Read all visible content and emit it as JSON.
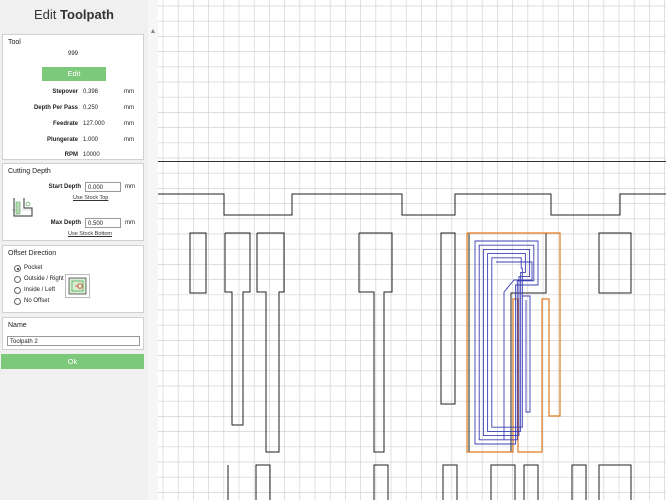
{
  "header": {
    "prefix": "Edit",
    "title": "Toolpath"
  },
  "tool": {
    "label": "Tool",
    "name": "999",
    "edit_label": "Edit",
    "fields": [
      {
        "label": "Stepover",
        "value": "0.398",
        "unit": "mm"
      },
      {
        "label": "Depth Per Pass",
        "value": "0.250",
        "unit": "mm"
      },
      {
        "label": "Feedrate",
        "value": "127.000",
        "unit": "mm"
      },
      {
        "label": "Plungerate",
        "value": "1.000",
        "unit": "mm"
      },
      {
        "label": "RPM",
        "value": "10000",
        "unit": ""
      }
    ]
  },
  "cutting_depth": {
    "label": "Cutting Depth",
    "start_label": "Start Depth",
    "start_value": "0.000",
    "start_unit": "mm",
    "use_top": "Use Stock Top",
    "max_label": "Max Depth",
    "max_value": "0.500",
    "max_unit": "mm",
    "use_bottom": "Use Stock Bottom"
  },
  "offset": {
    "label": "Offset Direction",
    "options": [
      "Pocket",
      "Outside / Right",
      "Inside / Left",
      "No Offset"
    ],
    "selected": "Pocket"
  },
  "name": {
    "label": "Name",
    "value": "Toolpath 2"
  },
  "ok_label": "Ok",
  "colors": {
    "accent": "#7dc97b",
    "toolpath": "#3b3fb5",
    "offset_path": "#e07a1f",
    "grid": "#d3d3d3"
  },
  "icons": {
    "depth": "depth-diagram-icon",
    "pocket": "pocket-offset-icon",
    "scroll": "scroll-up-icon"
  }
}
